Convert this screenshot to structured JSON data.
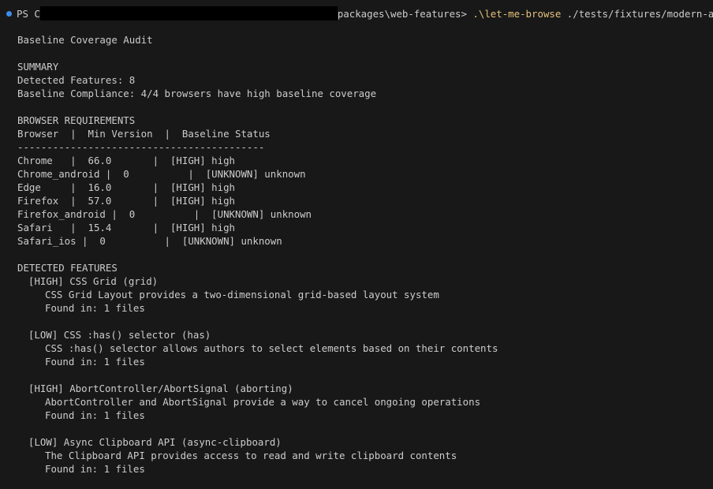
{
  "prompt": {
    "ps": "PS C",
    "path_tail": "packages\\web-features> ",
    "command": ".\\let-me-browse",
    "argument": " ./tests/fixtures/modern-app"
  },
  "title": "Baseline Coverage Audit",
  "summary": {
    "heading": "SUMMARY",
    "detected": "Detected Features: 8",
    "compliance": "Baseline Compliance: 4/4 browsers have high baseline coverage"
  },
  "requirements": {
    "heading": "BROWSER REQUIREMENTS",
    "header": "Browser  |  Min Version  |  Baseline Status",
    "divider": "------------------------------------------",
    "rows": [
      "Chrome   |  66.0       |  [HIGH] high",
      "Chrome_android |  0          |  [UNKNOWN] unknown",
      "Edge     |  16.0       |  [HIGH] high",
      "Firefox  |  57.0       |  [HIGH] high",
      "Firefox_android |  0          |  [UNKNOWN] unknown",
      "Safari   |  15.4       |  [HIGH] high",
      "Safari_ios |  0          |  [UNKNOWN] unknown"
    ]
  },
  "features": {
    "heading": "DETECTED FEATURES",
    "items": [
      {
        "title": "[HIGH] CSS Grid (grid)",
        "description": "CSS Grid Layout provides a two-dimensional grid-based layout system",
        "found": "Found in: 1 files"
      },
      {
        "title": "[LOW] CSS :has() selector (has)",
        "description": "CSS :has() selector allows authors to select elements based on their contents",
        "found": "Found in: 1 files"
      },
      {
        "title": "[HIGH] AbortController/AbortSignal (aborting)",
        "description": "AbortController and AbortSignal provide a way to cancel ongoing operations",
        "found": "Found in: 1 files"
      },
      {
        "title": "[LOW] Async Clipboard API (async-clipboard)",
        "description": "The Clipboard API provides access to read and write clipboard contents",
        "found": "Found in: 1 files"
      }
    ]
  }
}
